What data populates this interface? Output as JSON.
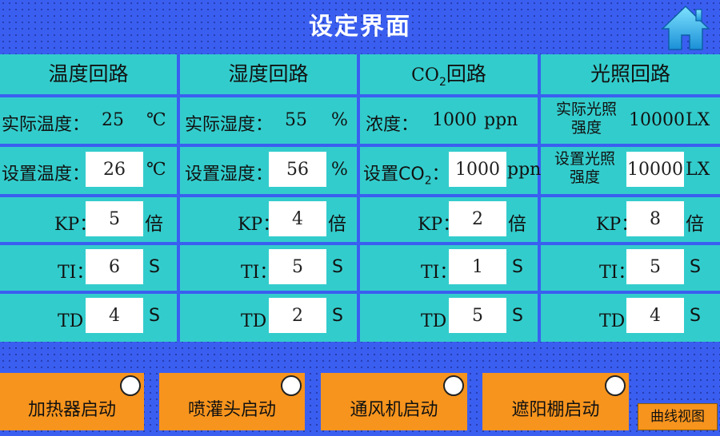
{
  "title": "设定界面",
  "colors": {
    "background": "#3a5ff0",
    "panel": "#33cccc",
    "button": "#f7941d"
  },
  "icons": {
    "home": "home-icon"
  },
  "headers": {
    "temp": "温度回路",
    "humid": "湿度回路",
    "co2_prefix": "CO",
    "co2_sub": "2",
    "co2_suffix": "回路",
    "light": "光照回路"
  },
  "temp": {
    "actual_label": "实际温度：",
    "actual_value": "25",
    "actual_unit": "℃",
    "set_label": "设置温度：",
    "set_value": "26",
    "set_unit": "℃",
    "kp": "5",
    "ti": "6",
    "td": "4"
  },
  "humid": {
    "actual_label": "实际湿度：",
    "actual_value": "55",
    "actual_unit": "%",
    "set_label": "设置湿度：",
    "set_value": "56",
    "set_unit": "%",
    "kp": "4",
    "ti": "5",
    "td": "2"
  },
  "co2": {
    "actual_label": "浓度：",
    "actual_value": "1000",
    "actual_unit": "ppn",
    "set_label_prefix": "设置CO",
    "set_label_sub": "2",
    "set_label_suffix": "：",
    "set_value": "1000",
    "set_unit": "ppn",
    "kp": "2",
    "ti": "1",
    "td": "5"
  },
  "light": {
    "actual_label_1": "实际光照",
    "actual_label_2": "强度",
    "actual_value": "10000",
    "actual_unit": "LX",
    "set_label_1": "设置光照",
    "set_label_2": "强度",
    "set_value": "10000",
    "set_unit": "LX",
    "kp": "8",
    "ti": "5",
    "td": "4"
  },
  "labels": {
    "kp": "KP：",
    "ti": "TI：",
    "td": "TD：",
    "kp_unit": "倍",
    "ti_unit": "S",
    "td_unit": "S"
  },
  "buttons": {
    "heater": "加热器启动",
    "sprinkler": "喷灌头启动",
    "fan": "通风机启动",
    "shade": "遮阳棚启动",
    "curve_view": "曲线视图"
  }
}
